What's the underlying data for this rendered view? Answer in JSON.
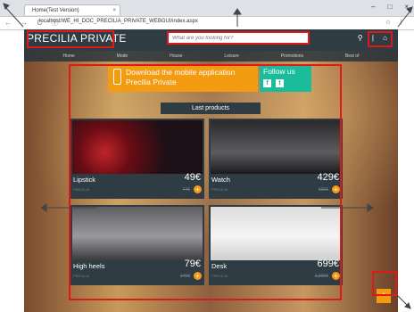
{
  "browser": {
    "tab_title": "Home(Test Version)",
    "tab_close": "×",
    "url": "localhost/WE_HI_DOC_PRECILIA_PRIVATE_WEBGUI/index.aspx",
    "nav_arrows": "← → C ⓘ",
    "addr_icons": "☆ ⋮",
    "win_controls": [
      "–",
      "□",
      "×"
    ]
  },
  "site": {
    "logo": "PRECILIA PRIVATE",
    "search_placeholder": "What are you looking for?",
    "header_icons": "⚲ | ⌂",
    "menu": [
      "Home",
      "Mode",
      "House",
      "Leisure",
      "Promotions",
      "Best of"
    ]
  },
  "banner": {
    "download_text_line1": "Download the mobile application",
    "download_text_line2": "Precilia Private",
    "follow_title": "Follow us",
    "social": [
      "f",
      "t"
    ]
  },
  "section_title": "Last products",
  "products": [
    {
      "name": "Lipstick",
      "brand": "PRECILIA",
      "price": "49€",
      "old_price": "74€"
    },
    {
      "name": "Watch",
      "brand": "PRECILIA",
      "price": "429€",
      "old_price": "639€"
    },
    {
      "name": "High heels",
      "brand": "PRECILIA",
      "price": "79€",
      "old_price": "149€"
    },
    {
      "name": "Desk",
      "brand": "PRECILIA",
      "price": "699€",
      "old_price": "1,299€"
    }
  ],
  "scroll_top_icon": "^",
  "colors": {
    "header": "#2f3c44",
    "accent_orange": "#f39c12",
    "accent_teal": "#1abc9c",
    "annotation_red": "#e01818"
  }
}
